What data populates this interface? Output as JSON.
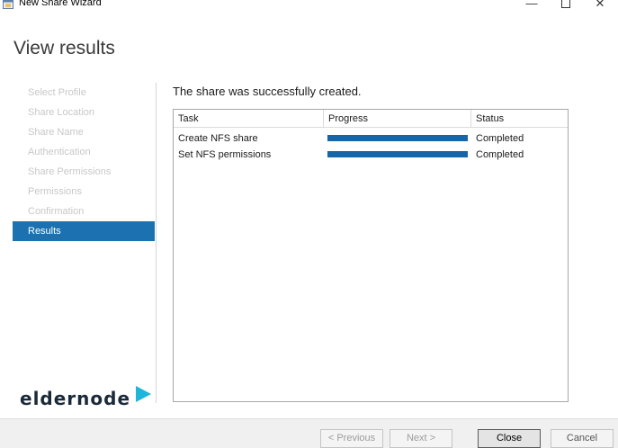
{
  "window": {
    "title": "New Share Wizard",
    "icon": "share-wizard-icon",
    "controls": {
      "minimize": "—",
      "maximize": "maximize-icon",
      "close": "✕"
    }
  },
  "page": {
    "title": "View results",
    "message": "The share was successfully created."
  },
  "nav": {
    "items": [
      {
        "label": "Select Profile",
        "active": false
      },
      {
        "label": "Share Location",
        "active": false
      },
      {
        "label": "Share Name",
        "active": false
      },
      {
        "label": "Authentication",
        "active": false
      },
      {
        "label": "Share Permissions",
        "active": false
      },
      {
        "label": "Permissions",
        "active": false
      },
      {
        "label": "Confirmation",
        "active": false
      },
      {
        "label": "Results",
        "active": true
      }
    ]
  },
  "results": {
    "columns": {
      "task": "Task",
      "progress": "Progress",
      "status": "Status"
    },
    "rows": [
      {
        "task": "Create NFS share",
        "progress_percent": 100,
        "status": "Completed"
      },
      {
        "task": "Set NFS permissions",
        "progress_percent": 100,
        "status": "Completed"
      }
    ]
  },
  "buttons": {
    "previous": "< Previous",
    "next": "Next >",
    "close": "Close",
    "cancel": "Cancel"
  },
  "watermark": {
    "logo_text": "eldernode"
  },
  "colors": {
    "accent": "#1c72b0",
    "progress": "#1565a8",
    "nav_inactive": "#c8c8c8"
  }
}
